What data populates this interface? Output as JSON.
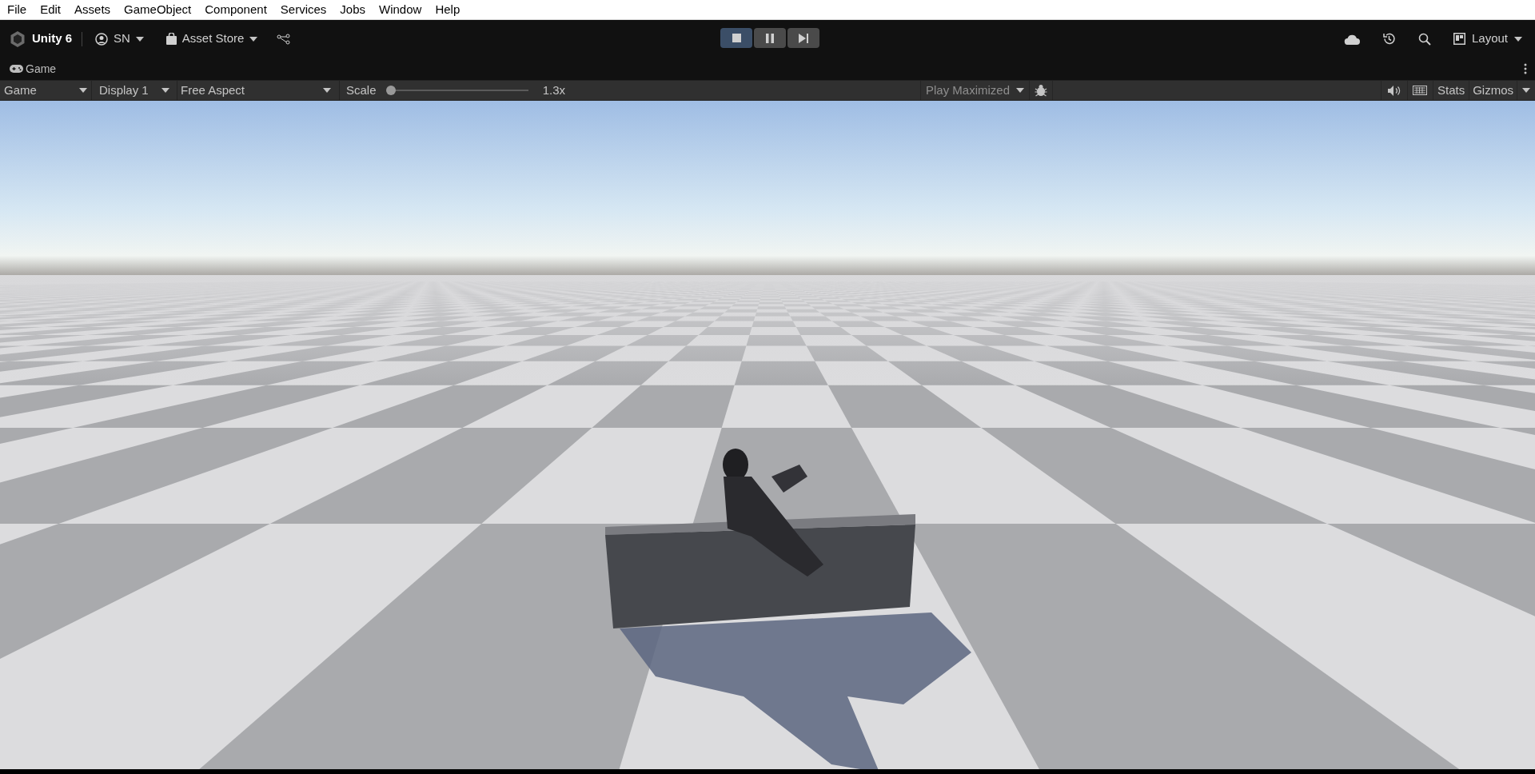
{
  "menu": [
    "File",
    "Edit",
    "Assets",
    "GameObject",
    "Component",
    "Services",
    "Jobs",
    "Window",
    "Help"
  ],
  "toolbar": {
    "brand": "Unity 6",
    "account": "SN",
    "asset_store": "Asset Store",
    "layout": "Layout"
  },
  "playback": [
    {
      "kind": "stop",
      "on": true
    },
    {
      "kind": "pause",
      "on": false
    },
    {
      "kind": "step",
      "on": false
    }
  ],
  "panel_tab": "Game",
  "game_toolbar": {
    "view": "Game",
    "display": "Display 1",
    "aspect": "Free Aspect",
    "scale_label": "Scale",
    "scale": {
      "level": 0
    },
    "scale_reading": "1.3x",
    "play_mode": "Play Maximized",
    "stats": "Stats",
    "gizmos": "Gizmos"
  }
}
